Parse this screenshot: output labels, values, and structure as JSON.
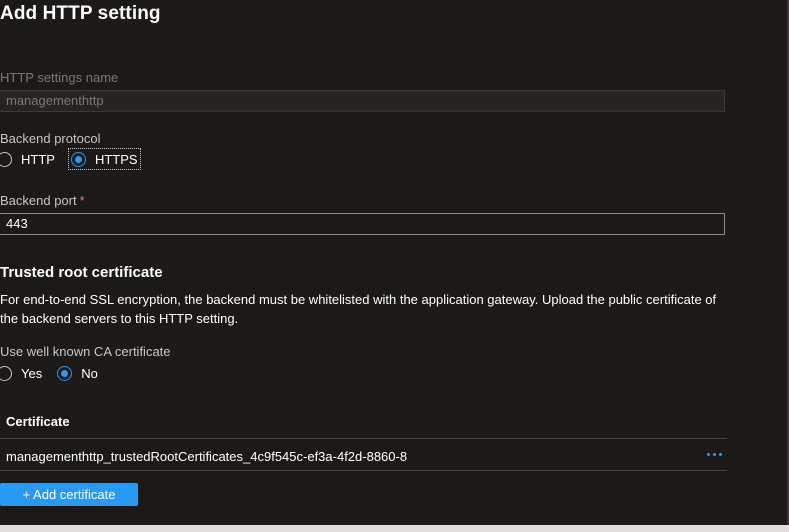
{
  "page": {
    "title": "Add HTTP setting"
  },
  "http_settings_name": {
    "label": "HTTP settings name",
    "value": "managementhttp"
  },
  "backend_protocol": {
    "label": "Backend protocol",
    "options": [
      "HTTP",
      "HTTPS"
    ],
    "selected": "HTTPS"
  },
  "backend_port": {
    "label": "Backend port",
    "required_marker": "*",
    "value": "443"
  },
  "trusted_root": {
    "heading": "Trusted root certificate",
    "description_line1": "For end-to-end SSL encryption, the backend must be whitelisted with the application gateway. Upload the public certificate of",
    "description_line2": "the backend servers to this HTTP setting."
  },
  "well_known_ca": {
    "label": "Use well known CA certificate",
    "options": [
      "Yes",
      "No"
    ],
    "selected": "No"
  },
  "certificates": {
    "column_header": "Certificate",
    "rows": [
      {
        "name": "managementhttp_trustedRootCertificates_4c9f545c-ef3a-4f2d-8860-8"
      }
    ],
    "more_icon": "ellipsis-icon",
    "add_button_label": "+ Add certificate"
  },
  "colors": {
    "background": "#1b1a19",
    "accent": "#2899f5",
    "required": "#f1707b"
  }
}
